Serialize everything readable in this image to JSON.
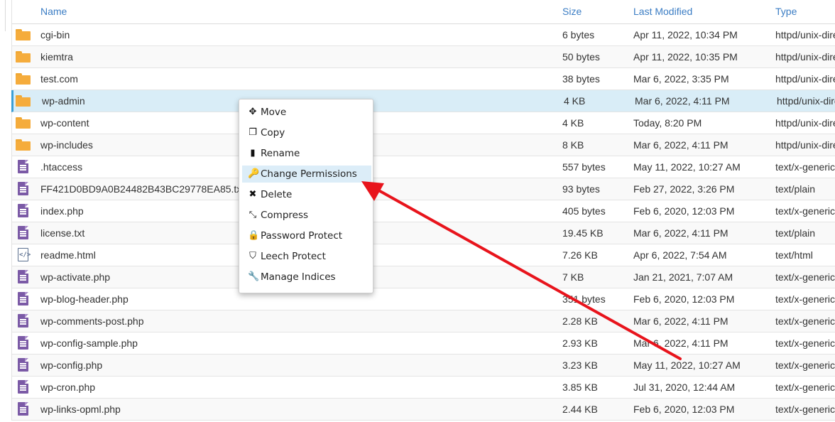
{
  "columns": {
    "name": "Name",
    "size": "Size",
    "modified": "Last Modified",
    "type": "Type"
  },
  "rows": [
    {
      "icon": "folder-icon",
      "name": "cgi-bin",
      "size": "6 bytes",
      "modified": "Apr 11, 2022, 10:34 PM",
      "type": "httpd/unix-directory"
    },
    {
      "icon": "folder-icon",
      "name": "kiemtra",
      "size": "50 bytes",
      "modified": "Apr 11, 2022, 10:35 PM",
      "type": "httpd/unix-directory"
    },
    {
      "icon": "folder-icon",
      "name": "test.com",
      "size": "38 bytes",
      "modified": "Mar 6, 2022, 3:35 PM",
      "type": "httpd/unix-directory"
    },
    {
      "icon": "folder-icon",
      "name": "wp-admin",
      "size": "4 KB",
      "modified": "Mar 6, 2022, 4:11 PM",
      "type": "httpd/unix-directory",
      "selected": true
    },
    {
      "icon": "folder-icon",
      "name": "wp-content",
      "size": "4 KB",
      "modified": "Today, 8:20 PM",
      "type": "httpd/unix-directory"
    },
    {
      "icon": "folder-icon",
      "name": "wp-includes",
      "size": "8 KB",
      "modified": "Mar 6, 2022, 4:11 PM",
      "type": "httpd/unix-directory"
    },
    {
      "icon": "text-file-icon",
      "name": ".htaccess",
      "size": "557 bytes",
      "modified": "May 11, 2022, 10:27 AM",
      "type": "text/x-generic"
    },
    {
      "icon": "text-file-icon",
      "name": "FF421D0BD9A0B24482B43BC29778EA85.txt",
      "size": "93 bytes",
      "modified": "Feb 27, 2022, 3:26 PM",
      "type": "text/plain"
    },
    {
      "icon": "text-file-icon",
      "name": "index.php",
      "size": "405 bytes",
      "modified": "Feb 6, 2020, 12:03 PM",
      "type": "text/x-generic"
    },
    {
      "icon": "text-file-icon",
      "name": "license.txt",
      "size": "19.45 KB",
      "modified": "Mar 6, 2022, 4:11 PM",
      "type": "text/plain"
    },
    {
      "icon": "html-file-icon",
      "name": "readme.html",
      "size": "7.26 KB",
      "modified": "Apr 6, 2022, 7:54 AM",
      "type": "text/html"
    },
    {
      "icon": "text-file-icon",
      "name": "wp-activate.php",
      "size": "7 KB",
      "modified": "Jan 21, 2021, 7:07 AM",
      "type": "text/x-generic"
    },
    {
      "icon": "text-file-icon",
      "name": "wp-blog-header.php",
      "size": "351 bytes",
      "modified": "Feb 6, 2020, 12:03 PM",
      "type": "text/x-generic"
    },
    {
      "icon": "text-file-icon",
      "name": "wp-comments-post.php",
      "size": "2.28 KB",
      "modified": "Mar 6, 2022, 4:11 PM",
      "type": "text/x-generic"
    },
    {
      "icon": "text-file-icon",
      "name": "wp-config-sample.php",
      "size": "2.93 KB",
      "modified": "Mar 6, 2022, 4:11 PM",
      "type": "text/x-generic"
    },
    {
      "icon": "text-file-icon",
      "name": "wp-config.php",
      "size": "3.23 KB",
      "modified": "May 11, 2022, 10:27 AM",
      "type": "text/x-generic"
    },
    {
      "icon": "text-file-icon",
      "name": "wp-cron.php",
      "size": "3.85 KB",
      "modified": "Jul 31, 2020, 12:44 AM",
      "type": "text/x-generic"
    },
    {
      "icon": "text-file-icon",
      "name": "wp-links-opml.php",
      "size": "2.44 KB",
      "modified": "Feb 6, 2020, 12:03 PM",
      "type": "text/x-generic"
    }
  ],
  "context_menu": {
    "items": [
      {
        "key": "move",
        "label": "Move",
        "icon": "move-arrows-icon"
      },
      {
        "key": "copy",
        "label": "Copy",
        "icon": "copy-icon"
      },
      {
        "key": "rename",
        "label": "Rename",
        "icon": "file-icon"
      },
      {
        "key": "change-permissions",
        "label": "Change Permissions",
        "icon": "key-icon",
        "highlighted": true
      },
      {
        "key": "delete",
        "label": "Delete",
        "icon": "x-icon"
      },
      {
        "key": "compress",
        "label": "Compress",
        "icon": "compress-icon"
      },
      {
        "key": "password-protect",
        "label": "Password Protect",
        "icon": "lock-icon"
      },
      {
        "key": "leech-protect",
        "label": "Leech Protect",
        "icon": "shield-icon"
      },
      {
        "key": "manage-indices",
        "label": "Manage Indices",
        "icon": "wrench-icon"
      }
    ]
  },
  "colors": {
    "link": "#3b7dc4",
    "folder": "#f5ac3c",
    "file": "#7b5aa6",
    "selected_row": "#d9edf7",
    "menu_highlight": "#dcedf8",
    "annotation_arrow": "#e8141c"
  }
}
